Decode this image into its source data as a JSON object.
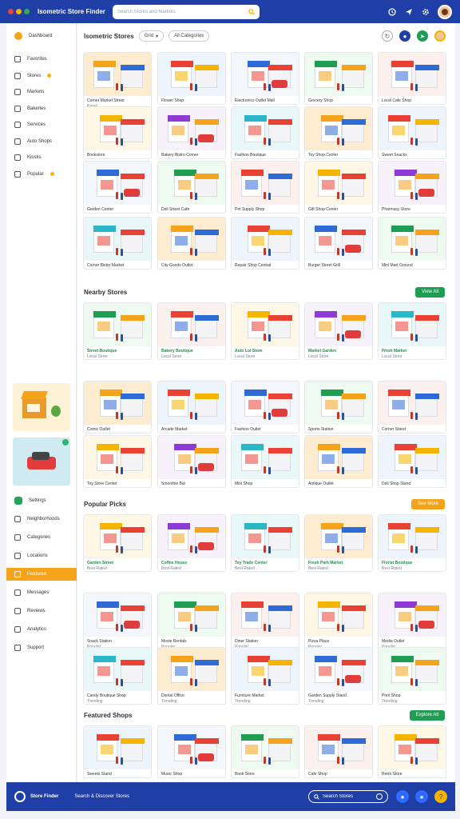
{
  "app": {
    "title": "Isometric Store Finder",
    "window_dots": [
      "#e94235",
      "#f5b400",
      "#34a853"
    ],
    "search_placeholder": "Search Stores and Markets",
    "accent": "#1f3fa6"
  },
  "sidebar": {
    "home_label": "Dashboard",
    "items": [
      {
        "label": "Favorites",
        "icon": "smile-icon"
      },
      {
        "label": "Stores",
        "icon": "store-icon",
        "badge": true
      },
      {
        "label": "Markets",
        "icon": "market-icon"
      },
      {
        "label": "Bakeries",
        "icon": "bakery-icon"
      },
      {
        "label": "Services",
        "icon": "service-icon"
      },
      {
        "label": "Auto Shops",
        "icon": "car-icon"
      },
      {
        "label": "Kiosks",
        "icon": "kiosk-icon"
      },
      {
        "label": "Popular",
        "icon": "star-icon",
        "badge": true
      }
    ],
    "lower_items": [
      {
        "label": "Settings",
        "icon": "gear-icon",
        "green": true
      },
      {
        "label": "Neighborhoods",
        "icon": "map-icon"
      },
      {
        "label": "Categories",
        "icon": "grid-icon"
      },
      {
        "label": "Locations",
        "icon": "pin-icon"
      },
      {
        "label": "Featured",
        "icon": "bookmark-icon",
        "active": true
      },
      {
        "label": "Messages",
        "icon": "message-icon"
      },
      {
        "label": "Reviews",
        "icon": "review-icon"
      },
      {
        "label": "Analytics",
        "icon": "chart-icon"
      },
      {
        "label": "Support",
        "icon": "help-icon"
      }
    ]
  },
  "toolbar": {
    "title": "Isometric Stores",
    "grid_toggle": "Grid",
    "filter_label": "All Categories"
  },
  "sections": [
    {
      "title": "Nearby Stores",
      "button": "View All",
      "button_color": "#1f9d52"
    },
    {
      "title": "Popular Picks",
      "button": "See More",
      "button_color": "#f5a31a"
    },
    {
      "title": "Featured Shops",
      "button": "Explore All",
      "button_color": "#1f9d52"
    }
  ],
  "grid_cards": [
    {
      "t1": "Corner Market Street",
      "t2": "Retail"
    },
    {
      "t1": "Flower Shop",
      "t2": ""
    },
    {
      "t1": "Electronics Outlet Mall",
      "t2": ""
    },
    {
      "t1": "Grocery Shop",
      "t2": ""
    },
    {
      "t1": "Local Cafe Shop",
      "t2": ""
    },
    {
      "t1": "Bookstore",
      "t2": ""
    },
    {
      "t1": "Bakery Bistro Corner",
      "t2": ""
    },
    {
      "t1": "Fashion Boutique",
      "t2": ""
    },
    {
      "t1": "Toy Shop Center",
      "t2": ""
    },
    {
      "t1": "Sweet Snacks",
      "t2": ""
    },
    {
      "t1": "Garden Center",
      "t2": ""
    },
    {
      "t1": "Deli Street Cafe",
      "t2": ""
    },
    {
      "t1": "Pet Supply Shop",
      "t2": ""
    },
    {
      "t1": "Gift Shop Center",
      "t2": ""
    },
    {
      "t1": "Pharmacy Store",
      "t2": ""
    },
    {
      "t1": "Corner Bistro Market",
      "t2": ""
    },
    {
      "t1": "City Goods Outlet",
      "t2": ""
    },
    {
      "t1": "Repair Shop Central",
      "t2": ""
    },
    {
      "t1": "Burger Street Grill",
      "t2": ""
    },
    {
      "t1": "Mini Mart Ground",
      "t2": ""
    }
  ],
  "nearby_cards": [
    {
      "t1": "Street Boutique",
      "t2": "Local Store"
    },
    {
      "t1": "Bakery Boutique",
      "t2": "Local Store"
    },
    {
      "t1": "Auto Lot Store",
      "t2": "Local Store"
    },
    {
      "t1": "Market Garden",
      "t2": "Local Store"
    },
    {
      "t1": "Fresh Market",
      "t2": "Local Store"
    },
    {
      "t1": "Comic Outlet",
      "t2": ""
    },
    {
      "t1": "Arcade Market",
      "t2": ""
    },
    {
      "t1": "Fashion Outlet",
      "t2": ""
    },
    {
      "t1": "Sports Station",
      "t2": ""
    },
    {
      "t1": "Corner Stand",
      "t2": ""
    },
    {
      "t1": "Toy Store Center",
      "t2": ""
    },
    {
      "t1": "Smoothie Bar",
      "t2": ""
    },
    {
      "t1": "Mini Shop",
      "t2": ""
    },
    {
      "t1": "Antique Outlet",
      "t2": ""
    },
    {
      "t1": "Deli Shop Stand",
      "t2": ""
    }
  ],
  "popular_cards": [
    {
      "t1": "Garden Street",
      "t2": "Best Rated"
    },
    {
      "t1": "Coffee House",
      "t2": "Best Rated"
    },
    {
      "t1": "Toy Trade Center",
      "t2": "Best Rated"
    },
    {
      "t1": "Fresh Park Market",
      "t2": "Best Rated"
    },
    {
      "t1": "Florist Boutique",
      "t2": "Best Rated"
    },
    {
      "t1": "Snack Station",
      "t2": "Popular"
    },
    {
      "t1": "Movie Rentals",
      "t2": "Popular"
    },
    {
      "t1": "Diner Station",
      "t2": "Popular"
    },
    {
      "t1": "Pizza Place",
      "t2": "Popular"
    },
    {
      "t1": "Media Outlet",
      "t2": "Popular"
    },
    {
      "t1": "Candy Boutique Shop",
      "t2": "Trending"
    },
    {
      "t1": "Dental Office",
      "t2": "Trending"
    },
    {
      "t1": "Furniture Market",
      "t2": "Trending"
    },
    {
      "t1": "Garden Supply Stand",
      "t2": "Trending"
    },
    {
      "t1": "Print Shop",
      "t2": "Trending"
    }
  ],
  "featured_cards": [
    {
      "t1": "Sweets Stand",
      "t2": ""
    },
    {
      "t1": "Music Shop",
      "t2": ""
    },
    {
      "t1": "Book Store",
      "t2": ""
    },
    {
      "t1": "Cafe Shop",
      "t2": ""
    },
    {
      "t1": "Retro Store",
      "t2": ""
    }
  ],
  "bottombar": {
    "brand": "Store Finder",
    "tagline": "Search & Discover Stores",
    "search_placeholder": "Search Stores"
  }
}
